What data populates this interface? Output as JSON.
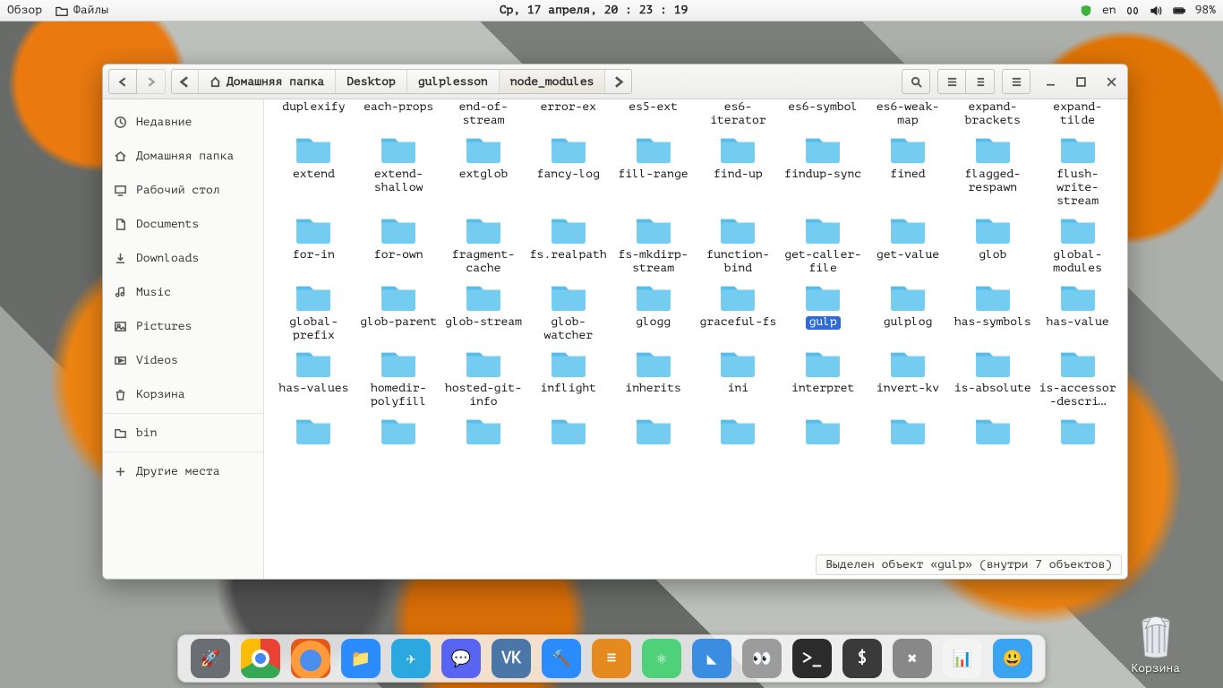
{
  "topbar": {
    "overview": "Обзор",
    "files": "Файлы",
    "datetime": "Ср, 17 апреля, 20 : 23 : 19",
    "lang": "en",
    "battery": "98%"
  },
  "window": {
    "breadcrumbs": {
      "home": "Домашняя папка",
      "desktop": "Desktop",
      "gulplesson": "gulplesson",
      "node_modules": "node_modules"
    },
    "status": "Выделен объект «gulp» (внутри 7 объектов)"
  },
  "sidebar": {
    "items": [
      {
        "label": "Недавние",
        "icon": "clock"
      },
      {
        "label": "Домашняя папка",
        "icon": "home"
      },
      {
        "label": "Рабочий стол",
        "icon": "desktop"
      },
      {
        "label": "Documents",
        "icon": "doc"
      },
      {
        "label": "Downloads",
        "icon": "down"
      },
      {
        "label": "Music",
        "icon": "music"
      },
      {
        "label": "Pictures",
        "icon": "pic"
      },
      {
        "label": "Videos",
        "icon": "vid"
      },
      {
        "label": "Корзина",
        "icon": "trash"
      }
    ],
    "bin": "bin",
    "other": "Другие места"
  },
  "folders": [
    "duplexif y",
    "each-props",
    "end-of-stream",
    "error-ex",
    "es5-ext",
    "es6-iterator",
    "es6-symbol",
    "es6-weak-map",
    "expand-brackets",
    "expand-tilde",
    "extend",
    "extend-shallow",
    "extglob",
    "fancy-log",
    "fill-range",
    "find-up",
    "findup-sync",
    "fined",
    "flagged-respawn",
    "flush-write-stream",
    "for-in",
    "for-own",
    "fragment -cache",
    "fs. realpath",
    "fs-mkdirp-stream",
    "function -bind",
    "get-caller-file",
    "get-value",
    "glob",
    "global-modules",
    "global-prefix",
    "glob-parent",
    "glob-stream",
    "glob-watcher",
    "glogg",
    "graceful -fs",
    "gulp",
    "gulplog",
    "has-symbols",
    "has-value",
    "has-values",
    "homedir-polyfill",
    "hosted-git-info",
    "inflight",
    "inherits",
    "ini",
    "interpre t",
    "invert-kv",
    "is-absolute",
    "is-accessor -descri…",
    "",
    "",
    "",
    "",
    "",
    "",
    "",
    "",
    "",
    ""
  ],
  "selected_index": 36,
  "trash_label": "Корзина",
  "dock": [
    {
      "bg": "#6a6d72",
      "txt": "🚀"
    },
    {
      "bg": "#ffffff",
      "txt": "C"
    },
    {
      "bg": "#4a8ff0",
      "txt": "🦊"
    },
    {
      "bg": "#2a8cff",
      "txt": "📁"
    },
    {
      "bg": "#2ca8e0",
      "txt": "✈"
    },
    {
      "bg": "#5865f2",
      "txt": "💬"
    },
    {
      "bg": "#4a76a8",
      "txt": "VK"
    },
    {
      "bg": "#2a8cff",
      "txt": "🔨"
    },
    {
      "bg": "#e58a1e",
      "txt": "≡"
    },
    {
      "bg": "#4fd17a",
      "txt": "⚛"
    },
    {
      "bg": "#3a8de0",
      "txt": "◣"
    },
    {
      "bg": "#9c9c9c",
      "txt": "👀"
    },
    {
      "bg": "#2b2b2b",
      "txt": ">_"
    },
    {
      "bg": "#3a3a3a",
      "txt": "$"
    },
    {
      "bg": "#888",
      "txt": "✖"
    },
    {
      "bg": "#f4f4f4",
      "txt": "📊"
    },
    {
      "bg": "#3aa3f2",
      "txt": "😃"
    }
  ]
}
